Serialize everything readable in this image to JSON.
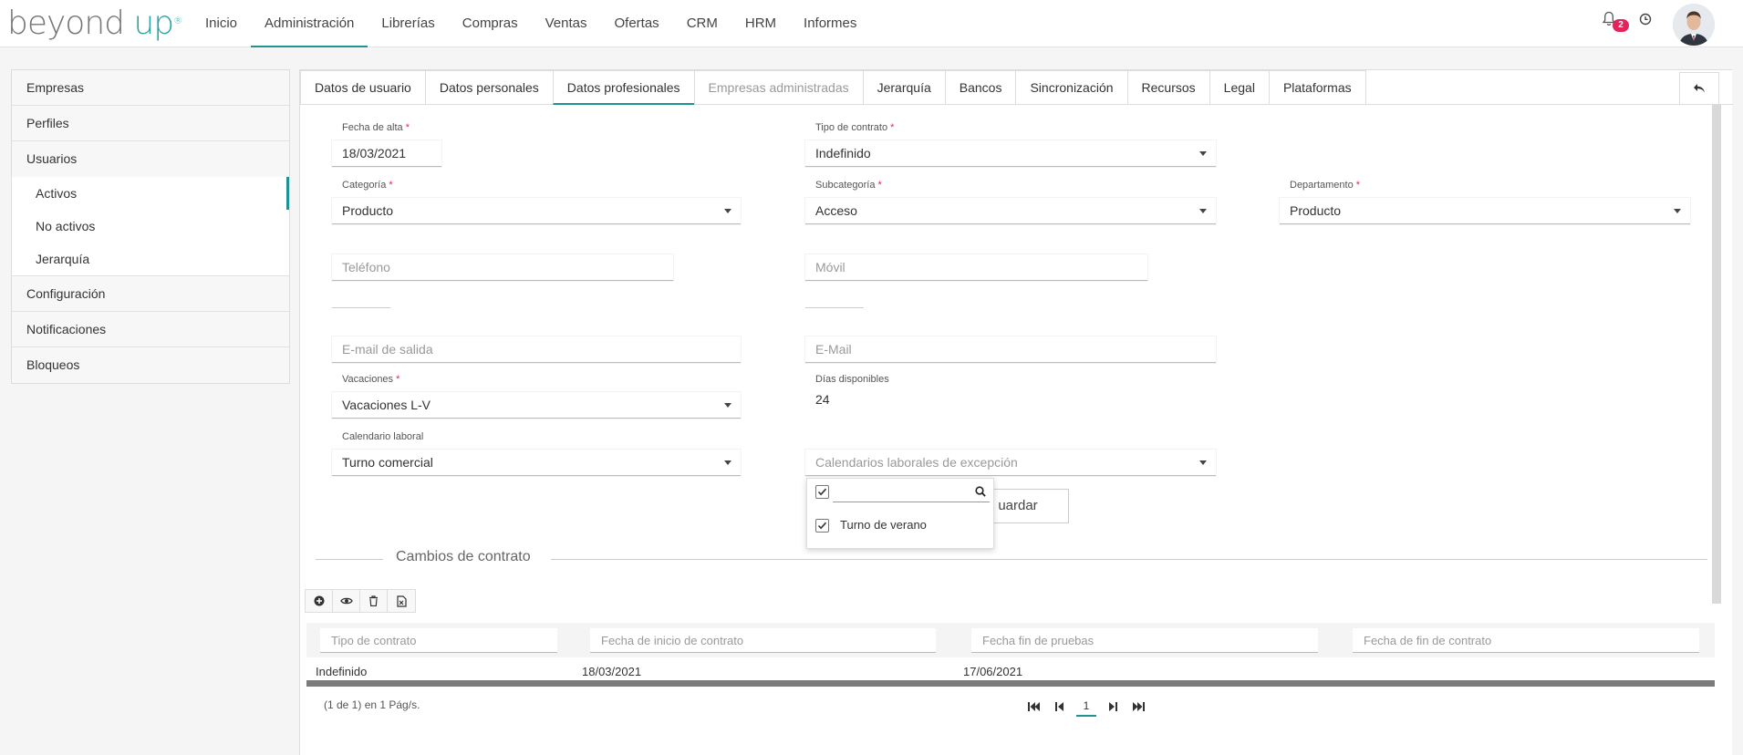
{
  "brand": {
    "name": "beyond",
    "accent": "up",
    "mark": "®",
    "color": "#2aa3a3"
  },
  "nav": {
    "items": [
      "Inicio",
      "Administración",
      "Librerías",
      "Compras",
      "Ventas",
      "Ofertas",
      "CRM",
      "HRM",
      "Informes"
    ],
    "active": "Administración"
  },
  "header": {
    "notifications_count": "2",
    "icons": [
      "bell-icon",
      "clock-icon",
      "avatar"
    ]
  },
  "sidebar": {
    "items": {
      "empresas": "Empresas",
      "perfiles": "Perfiles",
      "usuarios": "Usuarios",
      "activos": "Activos",
      "no_activos": "No activos",
      "jerarquia": "Jerarquía",
      "configuracion": "Configuración",
      "notificaciones": "Notificaciones",
      "bloqueos": "Bloqueos"
    },
    "active": "Activos"
  },
  "tabs": {
    "datos_usuario": "Datos de usuario",
    "datos_personales": "Datos personales",
    "datos_profesionales": "Datos profesionales",
    "empresas_administradas": "Empresas administradas",
    "jerarquia": "Jerarquía",
    "bancos": "Bancos",
    "sincronizacion": "Sincronización",
    "recursos": "Recursos",
    "legal": "Legal",
    "plataformas": "Plataformas",
    "active": "Datos profesionales",
    "disabled": "Empresas administradas"
  },
  "form": {
    "fecha_alta": {
      "label": "Fecha de alta",
      "required": "*",
      "value": "18/03/2021"
    },
    "tipo_contrato": {
      "label": "Tipo de contrato",
      "required": "*",
      "value": "Indefinido"
    },
    "categoria": {
      "label": "Categoría",
      "required": "*",
      "value": "Producto"
    },
    "subcategoria": {
      "label": "Subcategoría",
      "required": "*",
      "value": "Acceso"
    },
    "departamento": {
      "label": "Departamento",
      "required": "*",
      "value": "Producto"
    },
    "telefono": {
      "placeholder": "Teléfono"
    },
    "movil": {
      "placeholder": "Móvil"
    },
    "email_salida": {
      "placeholder": "E-mail de salida"
    },
    "email": {
      "placeholder": "E-Mail"
    },
    "vacaciones": {
      "label": "Vacaciones",
      "required": "*",
      "value": "Vacaciones L-V"
    },
    "dias_disponibles": {
      "label": "Días disponibles",
      "value": "24"
    },
    "calendario_laboral": {
      "label": "Calendario laboral",
      "value": "Turno comercial"
    },
    "calendarios_excepcion": {
      "placeholder": "Calendarios laborales de excepción"
    },
    "save_label": "uardar"
  },
  "dropdown": {
    "select_all_checked": true,
    "search_value": "",
    "options": [
      {
        "label": "Turno de verano",
        "checked": true
      }
    ]
  },
  "contract_changes": {
    "title": "Cambios de contrato",
    "toolbar": [
      "add-icon",
      "view-icon",
      "delete-icon",
      "export-excel-icon"
    ],
    "filters": [
      "Tipo de contrato",
      "Fecha de inicio de contrato",
      "Fecha fin de pruebas",
      "Fecha de fin de contrato"
    ],
    "rows": [
      {
        "tipo": "Indefinido",
        "inicio": "18/03/2021",
        "fin_pruebas": "17/06/2021",
        "fin_contrato": ""
      }
    ],
    "pagination": {
      "info": "(1 de 1) en 1 Pág/s.",
      "current_page": "1"
    }
  }
}
